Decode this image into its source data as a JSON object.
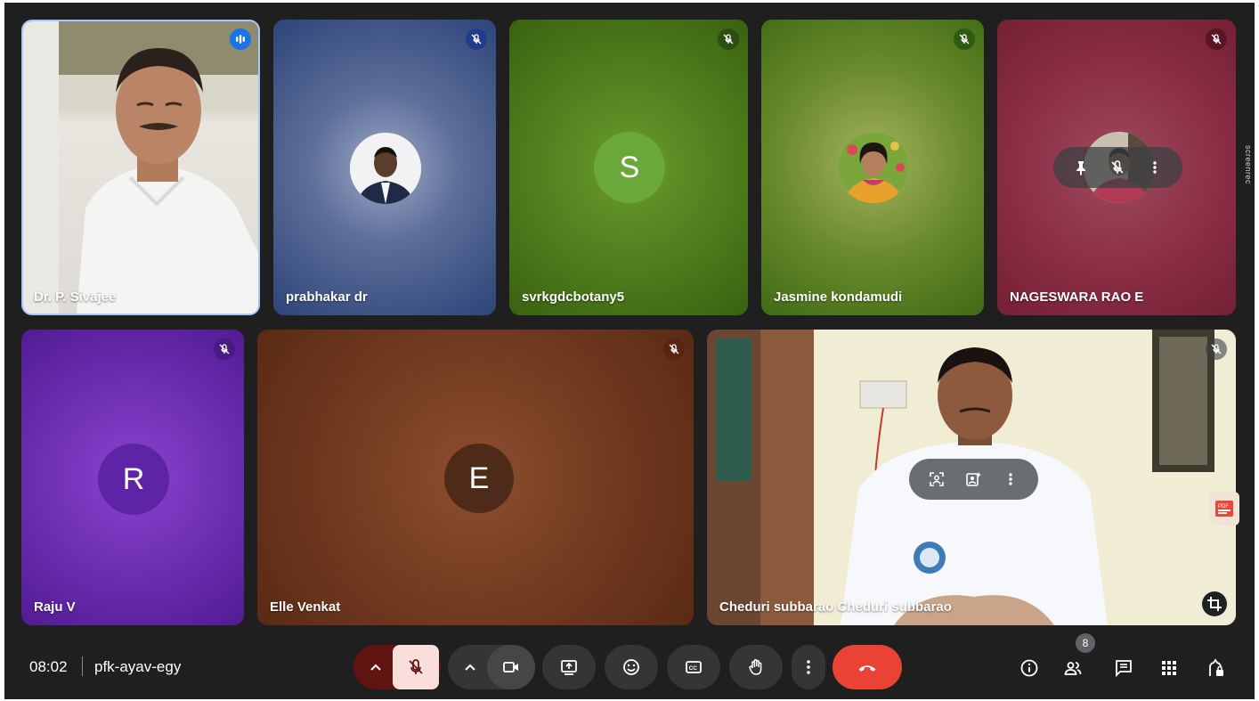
{
  "participants": [
    {
      "name": "Dr. P. Sivajee",
      "state": "speaking"
    },
    {
      "name": "prabhakar dr",
      "state": "muted"
    },
    {
      "name": "svrkgdcbotany5",
      "state": "muted",
      "initial": "S"
    },
    {
      "name": "Jasmine kondamudi",
      "state": "muted"
    },
    {
      "name": "NAGESWARA RAO E",
      "state": "muted"
    },
    {
      "name": "Raju V",
      "state": "muted",
      "initial": "R"
    },
    {
      "name": "Elle Venkat",
      "state": "muted",
      "initial": "E"
    },
    {
      "name": "Cheduri subbarao Cheduri subbarao",
      "state": "muted"
    }
  ],
  "colors": {
    "background": "#1f1f1f",
    "end_call": "#ea4335",
    "mic_off_bg": "#f9dedc",
    "mic_arrow_bg": "#601410",
    "active_border": "#a8c7fa"
  },
  "meeting": {
    "time": "08:02",
    "code": "pfk-ayav-egy"
  },
  "people_count": "8",
  "watermark": "screenrec",
  "icons": {
    "tile_hover": [
      "pin-icon",
      "mic-off-icon",
      "more-vert-icon"
    ],
    "self_view": [
      "frame-person-icon",
      "background-effects-icon",
      "more-vert-icon"
    ],
    "controls": [
      "chevron-up-icon",
      "mic-off-icon",
      "chevron-up-icon",
      "videocam-icon",
      "present-icon",
      "emoji-icon",
      "captions-icon",
      "raise-hand-icon",
      "more-vert-icon",
      "call-end-icon"
    ],
    "right": [
      "info-icon",
      "people-icon",
      "chat-icon",
      "activities-icon",
      "host-controls-icon"
    ],
    "side": [
      "pdf-icon",
      "crop-icon"
    ]
  }
}
